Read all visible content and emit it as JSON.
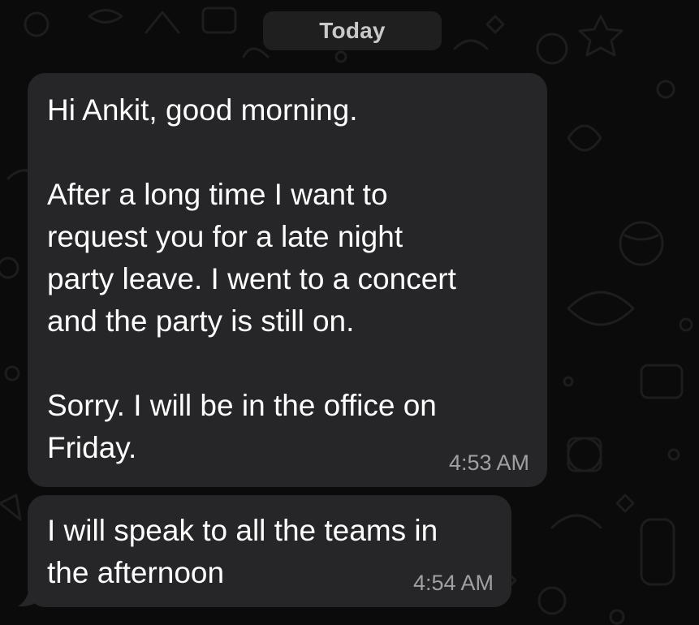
{
  "date_separator": "Today",
  "messages": [
    {
      "paragraphs": [
        "Hi Ankit, good morning.",
        "After a long time I want to\nrequest you for a late night\nparty leave. I went to a concert\nand the party is still on.",
        "Sorry. I will be in the office on\nFriday."
      ],
      "time": "4:53 AM"
    },
    {
      "paragraphs": [
        "I will speak to all the teams in\nthe afternoon"
      ],
      "time": "4:54 AM"
    }
  ],
  "colors": {
    "background": "#0b0b0b",
    "bubble": "#262628",
    "text": "#ffffff",
    "timestamp": "#a0a0a4",
    "date_pill": "#1f1f1f"
  }
}
